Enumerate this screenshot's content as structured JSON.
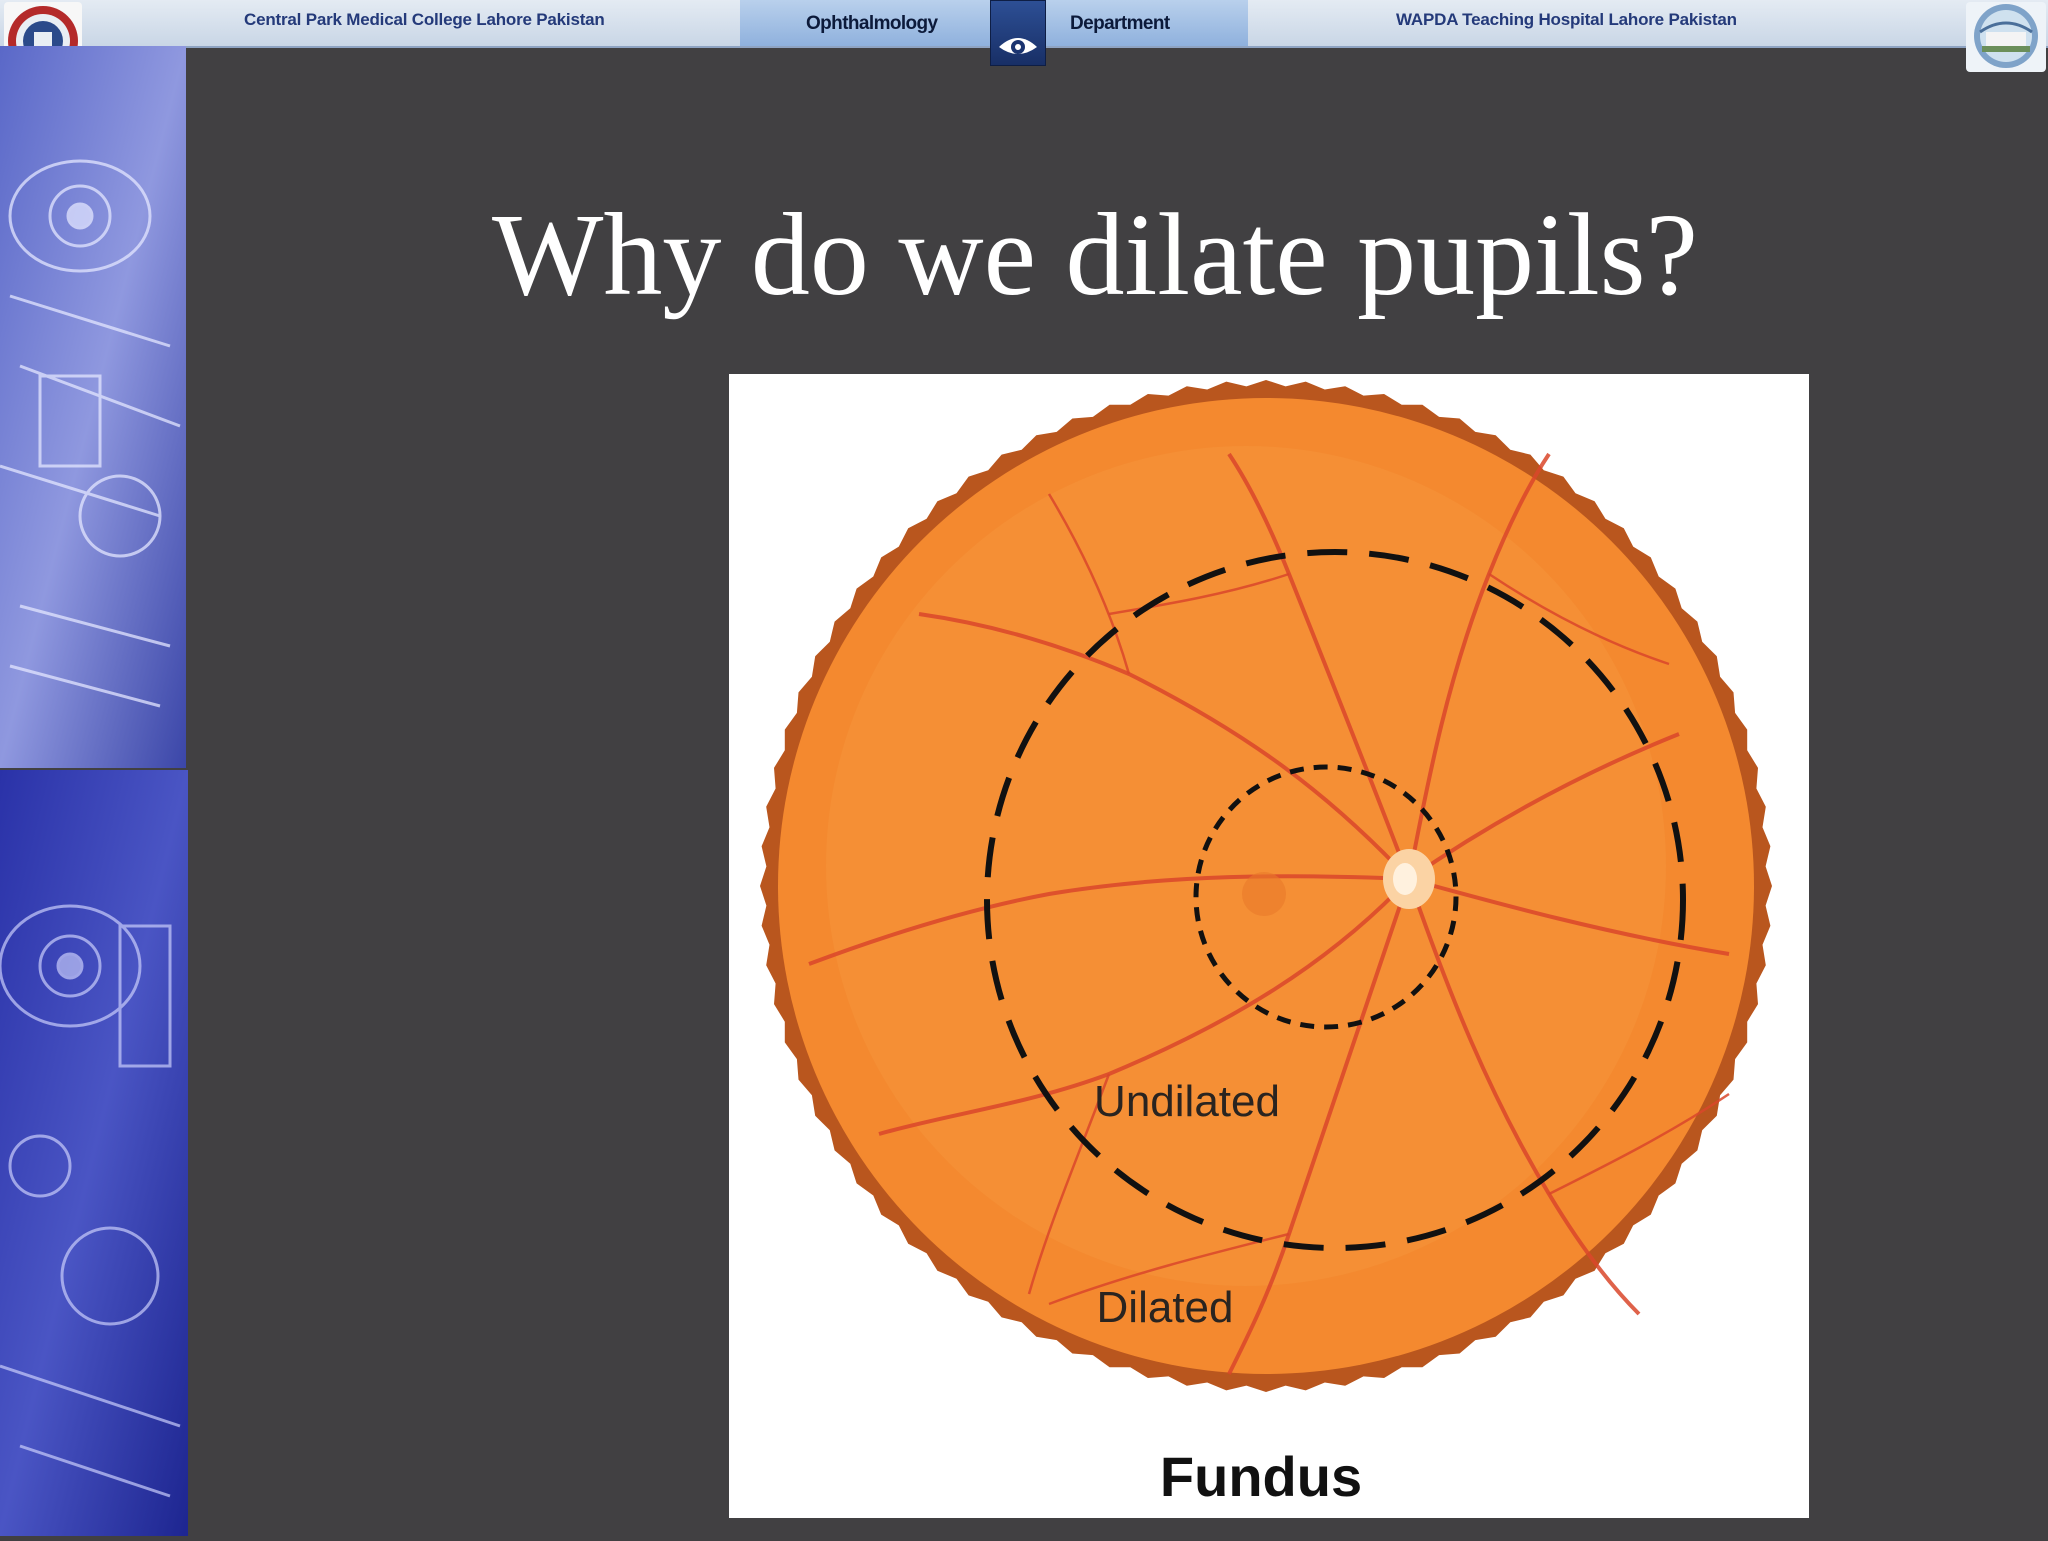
{
  "header": {
    "left_text": "Central Park Medical College Lahore  Pakistan",
    "dept_left": "Ophthalmology",
    "dept_right": "Department",
    "right_text": "WAPDA Teaching Hospital  Lahore Pakistan"
  },
  "slide": {
    "title": "Why do we dilate pupils?"
  },
  "figure": {
    "label_undilated": "Undilated",
    "label_dilated": "Dilated",
    "caption": "Fundus",
    "colors": {
      "fundus": "#f4892f",
      "rim": "#b9561e",
      "vessels": "#d9472a",
      "dash": "#111111"
    }
  }
}
